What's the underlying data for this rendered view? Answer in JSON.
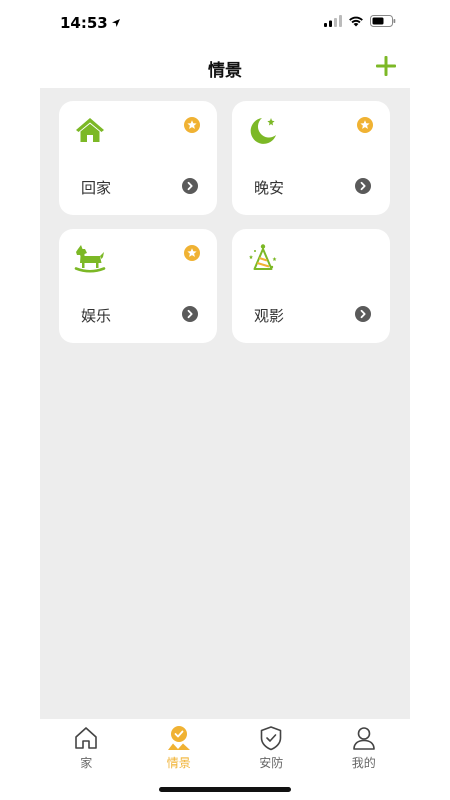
{
  "status": {
    "time": "14:53"
  },
  "header": {
    "title": "情景"
  },
  "scenes": [
    {
      "label": "回家",
      "icon": "home-icon",
      "favorite": true
    },
    {
      "label": "晚安",
      "icon": "moon-icon",
      "favorite": true
    },
    {
      "label": "娱乐",
      "icon": "rocking-horse-icon",
      "favorite": true
    },
    {
      "label": "观影",
      "icon": "party-hat-icon",
      "favorite": false
    }
  ],
  "tabs": [
    {
      "label": "家",
      "icon": "house-icon",
      "active": false
    },
    {
      "label": "情景",
      "icon": "scene-icon",
      "active": true
    },
    {
      "label": "安防",
      "icon": "shield-icon",
      "active": false
    },
    {
      "label": "我的",
      "icon": "user-icon",
      "active": false
    }
  ],
  "colors": {
    "accent_green": "#7cb826",
    "accent_gold": "#f0b233",
    "content_bg": "#ededed"
  }
}
